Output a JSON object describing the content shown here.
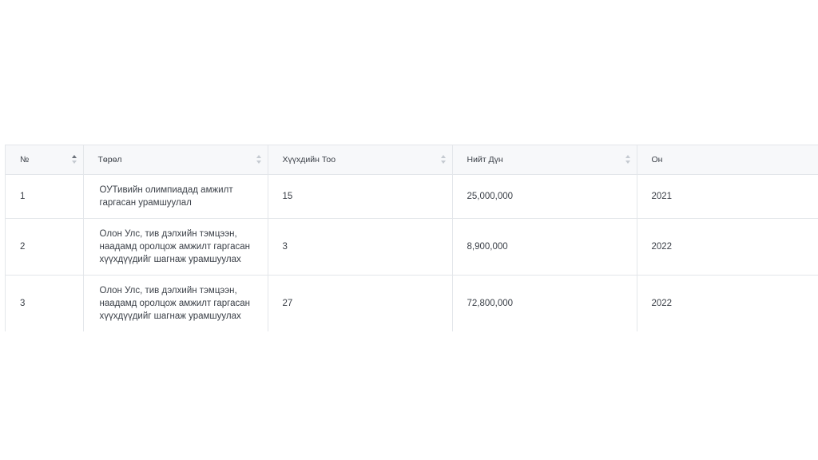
{
  "table": {
    "columns": [
      {
        "label": "№",
        "sort": "asc"
      },
      {
        "label": "Төрөл",
        "sort": "none"
      },
      {
        "label": "Хүүхдийн Тоо",
        "sort": "none"
      },
      {
        "label": "Нийт Дүн",
        "sort": "none"
      },
      {
        "label": "Он",
        "sort": "none"
      }
    ],
    "rows": [
      {
        "no": "1",
        "type": "ОУТивийн олимпиадад амжилт гаргасан урамшуулал",
        "children": "15",
        "total": "25,000,000",
        "year": "2021"
      },
      {
        "no": "2",
        "type": "Олон Улс, тив дэлхийн тэмцээн, наадамд оролцож амжилт гаргасан хүүхдүүдийг шагнаж урамшуулах",
        "children": "3",
        "total": "8,900,000",
        "year": "2022"
      },
      {
        "no": "3",
        "type": "Олон Улс, тив дэлхийн тэмцээн, наадамд оролцож амжилт гаргасан хүүхдүүдийг шагнаж урамшуулах",
        "children": "27",
        "total": "72,800,000",
        "year": "2022"
      }
    ]
  }
}
